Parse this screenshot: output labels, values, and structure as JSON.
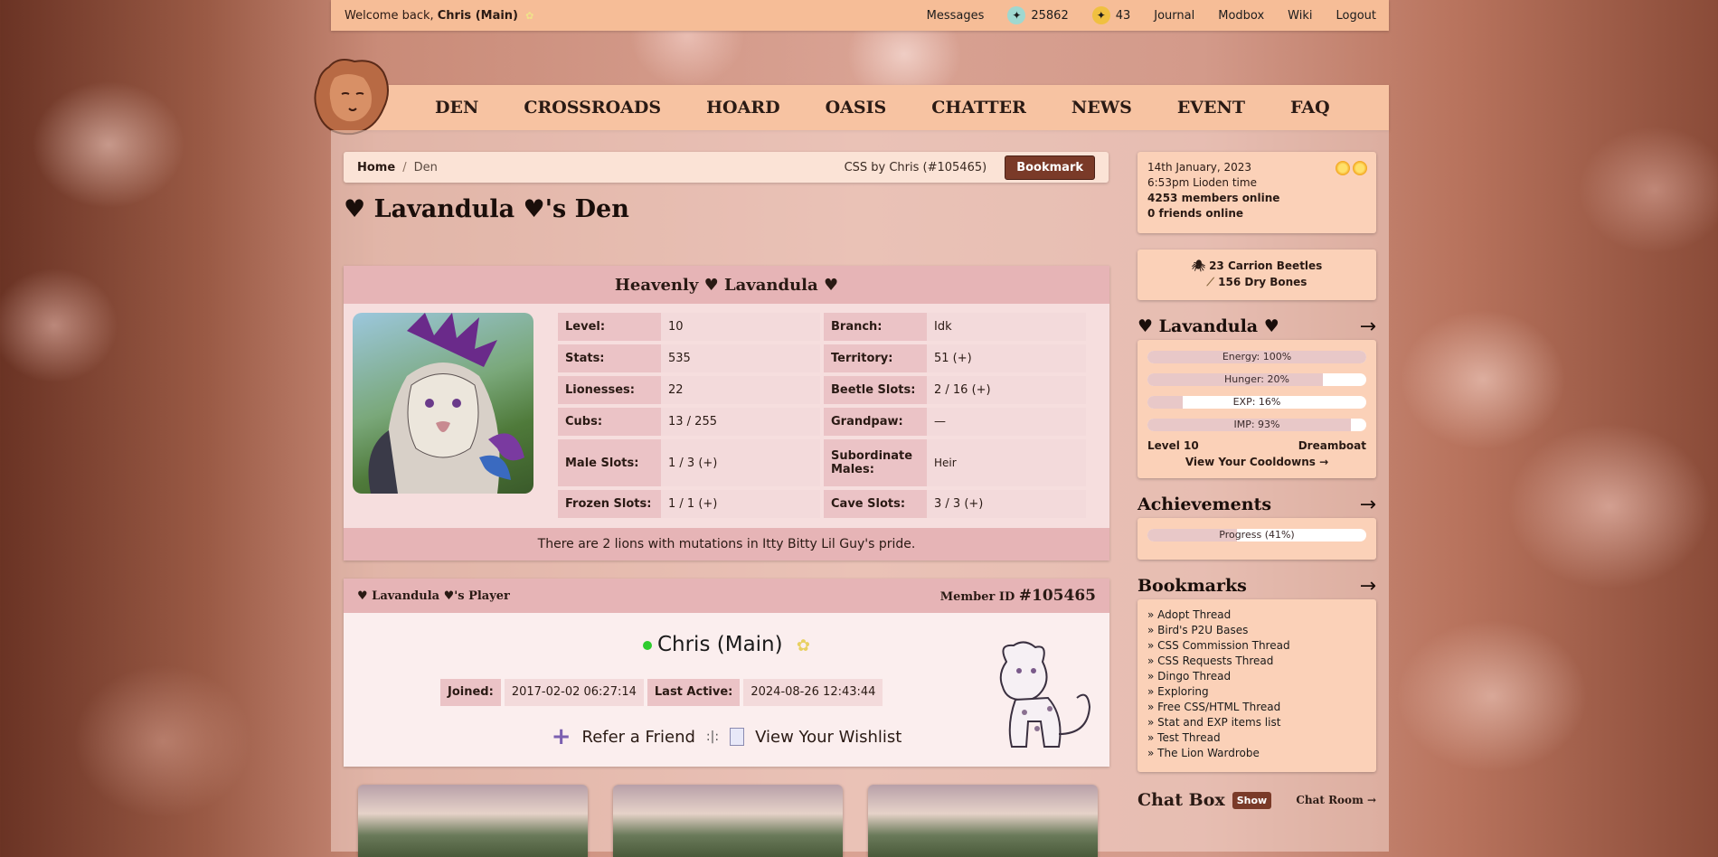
{
  "topbar": {
    "welcome_prefix": "Welcome back,",
    "username": "Chris (Main)",
    "links": {
      "messages": "Messages",
      "currency_sb": "25862",
      "currency_gb": "43",
      "journal": "Journal",
      "modbox": "Modbox",
      "wiki": "Wiki",
      "logout": "Logout"
    }
  },
  "nav": [
    "DEN",
    "CROSSROADS",
    "HOARD",
    "OASIS",
    "CHATTER",
    "NEWS",
    "EVENT",
    "FAQ"
  ],
  "breadcrumb": {
    "home": "Home",
    "sep": "/",
    "current": "Den",
    "css_credit": "CSS by Chris (#105465)",
    "bookmark": "Bookmark"
  },
  "page_title": "♥ Lavandula ♥'s Den",
  "lion": {
    "name": "Heavenly ♥ Lavandula ♥",
    "stats": [
      {
        "k": "Level:",
        "v": "10",
        "k2": "Branch:",
        "v2": "Idk"
      },
      {
        "k": "Stats:",
        "v": "535",
        "k2": "Territory:",
        "v2": "51 (+)"
      },
      {
        "k": "Lionesses:",
        "v": "22",
        "k2": "Beetle Slots:",
        "v2": "2 / 16 (+)"
      },
      {
        "k": "Cubs:",
        "v": "13 / 255",
        "k2": "Grandpaw:",
        "v2": "—"
      },
      {
        "k": "Male Slots:",
        "v": "1 / 3 (+)",
        "k2": "Subordinate Males:",
        "v2": "Heir"
      },
      {
        "k": "Frozen Slots:",
        "v": "1 / 1 (+)",
        "k2": "Cave Slots:",
        "v2": "3 / 3 (+)"
      }
    ],
    "mutation_note": "There are 2 lions with mutations in Itty Bitty Lil Guy's pride."
  },
  "player": {
    "header_left": "♥ Lavandula ♥'s Player",
    "header_right_label": "Member ID",
    "member_id": "#105465",
    "name": "Chris (Main)",
    "joined_label": "Joined:",
    "joined": "2017-02-02 06:27:14",
    "active_label": "Last Active:",
    "active": "2024-08-26 12:43:44",
    "refer": "Refer a Friend",
    "divider": ":|:",
    "wishlist": "View Your Wishlist"
  },
  "sidebar": {
    "date": "14th January, 2023",
    "time": "6:53pm Lioden time",
    "members_online": "4253 members online",
    "friends_online": "0 friends online",
    "beetles": "23 Carrion Beetles",
    "bones": "156 Dry Bones",
    "lion_heading": "♥ Lavandula ♥",
    "energy": {
      "label": "Energy: 100%",
      "value": 100
    },
    "hunger": {
      "label": "Hunger: 20%",
      "value": 80
    },
    "exp": {
      "label": "EXP: 16%",
      "value": 16
    },
    "imp": {
      "label": "IMP: 93%",
      "value": 93
    },
    "level": "Level 10",
    "title": "Dreamboat",
    "cooldowns": "View Your Cooldowns →",
    "achievements_heading": "Achievements",
    "achievements_progress": {
      "label": "Progress (41%)",
      "value": 41
    },
    "bookmarks_heading": "Bookmarks",
    "bookmarks": [
      "» Adopt Thread",
      "» Bird's P2U Bases",
      "» CSS Commission Thread",
      "» CSS Requests Thread",
      "» Dingo Thread",
      "» Exploring",
      "» Free CSS/HTML Thread",
      "» Stat and EXP items list",
      "» Test Thread",
      "» The Lion Wardrobe"
    ],
    "chat_heading": "Chat Box",
    "chat_show": "Show",
    "chat_room": "Chat Room →",
    "arrow": "→"
  },
  "colors": {
    "accent": "#7a3a28",
    "topbar": "#f6bd97",
    "card_header": "#e6b4b6",
    "online": "#2ecc2e"
  }
}
